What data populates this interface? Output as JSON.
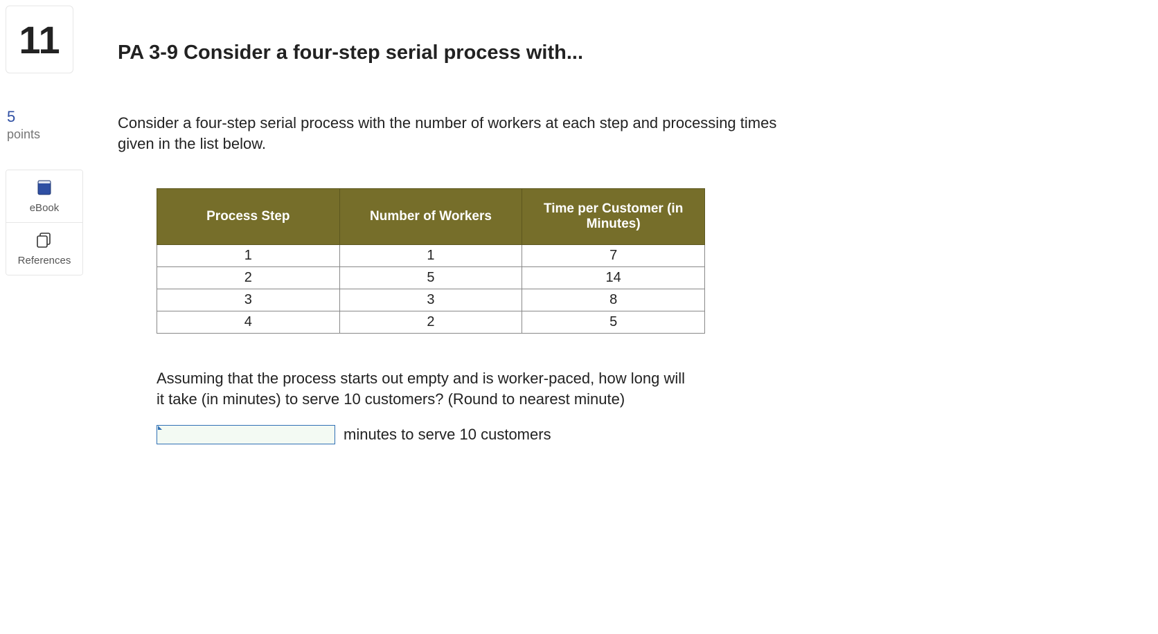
{
  "question_number": "11",
  "points": {
    "value": "5",
    "label": "points"
  },
  "resources": {
    "ebook_label": "eBook",
    "references_label": "References"
  },
  "title": "PA 3-9 Consider a four-step serial process with...",
  "intro_text": "Consider a four-step serial process with the number of workers at each step and processing times given in the list below.",
  "table": {
    "headers": [
      "Process Step",
      "Number of Workers",
      "Time per Customer (in Minutes)"
    ],
    "rows": [
      {
        "step": "1",
        "workers": "1",
        "time": "7"
      },
      {
        "step": "2",
        "workers": "5",
        "time": "14"
      },
      {
        "step": "3",
        "workers": "3",
        "time": "8"
      },
      {
        "step": "4",
        "workers": "2",
        "time": "5"
      }
    ]
  },
  "sub_question": "Assuming that the process starts out empty and is worker-paced, how long will it take (in minutes) to serve 10 customers? (Round to nearest minute)",
  "answer": {
    "value": "",
    "suffix": "minutes to serve 10 customers"
  },
  "chart_data": {
    "type": "table",
    "title": "Four-step serial process data",
    "columns": [
      "Process Step",
      "Number of Workers",
      "Time per Customer (in Minutes)"
    ],
    "rows": [
      [
        1,
        1,
        7
      ],
      [
        2,
        5,
        14
      ],
      [
        3,
        3,
        8
      ],
      [
        4,
        2,
        5
      ]
    ]
  }
}
